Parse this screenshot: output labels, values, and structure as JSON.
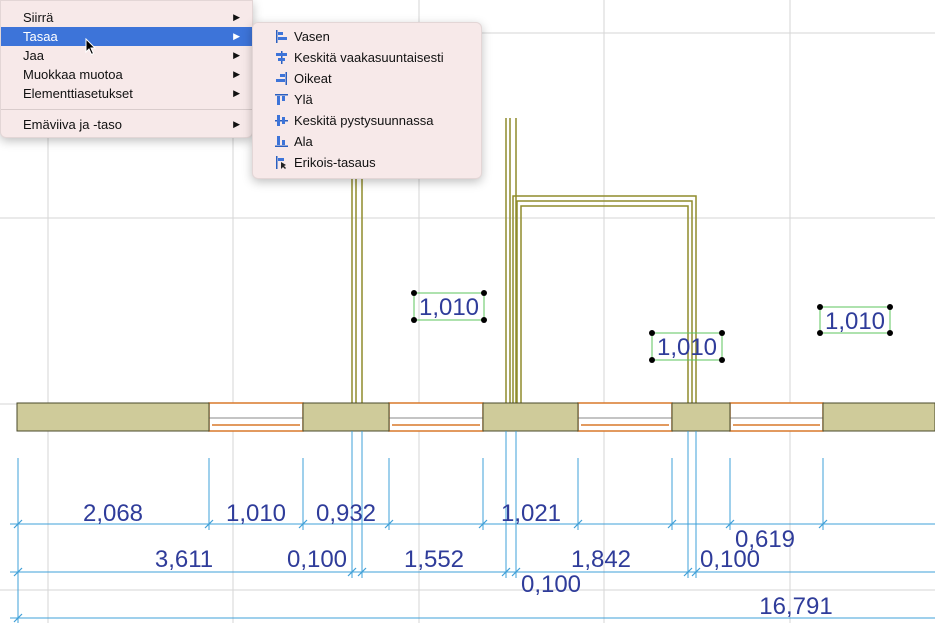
{
  "context_menu": {
    "items": [
      {
        "label": "Siirrä",
        "has_submenu": true
      },
      {
        "label": "Tasaa",
        "has_submenu": true,
        "selected": true
      },
      {
        "label": "Jaa",
        "has_submenu": true
      },
      {
        "label": "Muokkaa muotoa",
        "has_submenu": true
      },
      {
        "label": "Elementtiasetukset",
        "has_submenu": true
      },
      {
        "label": "Emäviiva ja -taso",
        "has_submenu": true
      }
    ],
    "submenu_arrow": "▶"
  },
  "submenu": {
    "items": [
      {
        "label": "Vasen",
        "icon": "align-left-icon"
      },
      {
        "label": "Keskitä vaakasuuntaisesti",
        "icon": "align-center-horizontal-icon"
      },
      {
        "label": "Oikeat",
        "icon": "align-right-icon"
      },
      {
        "label": "Ylä",
        "icon": "align-top-icon"
      },
      {
        "label": "Keskitä pystysuunnassa",
        "icon": "align-center-vertical-icon"
      },
      {
        "label": "Ala",
        "icon": "align-bottom-icon"
      },
      {
        "label": "Erikois-tasaus",
        "icon": "special-align-icon"
      }
    ]
  },
  "drawing": {
    "window_tags": [
      "1,010",
      "1,010",
      "1,010"
    ],
    "dimensions_row1": [
      "2,068",
      "1,010",
      "0,932",
      "1,021",
      "0,619"
    ],
    "dimensions_row2": [
      "3,611",
      "0,100",
      "1,552",
      "1,842",
      "0,100"
    ],
    "dimensions_row2b": [
      "0,100"
    ],
    "dimensions_total": [
      "16,791"
    ]
  },
  "colors": {
    "menu_bg": "#f7e9e9",
    "selection": "#3d74d9",
    "grid": "#d6d6d6",
    "wall_fill": "#cfcb9a",
    "wall_stroke": "#4a4a2a",
    "dimension_line": "#3fa0d8",
    "dimension_text": "#2f3c9a",
    "olive_line": "#8f8c2c",
    "window_frame": "#d9782a",
    "tag_box": "#5cc45c"
  }
}
